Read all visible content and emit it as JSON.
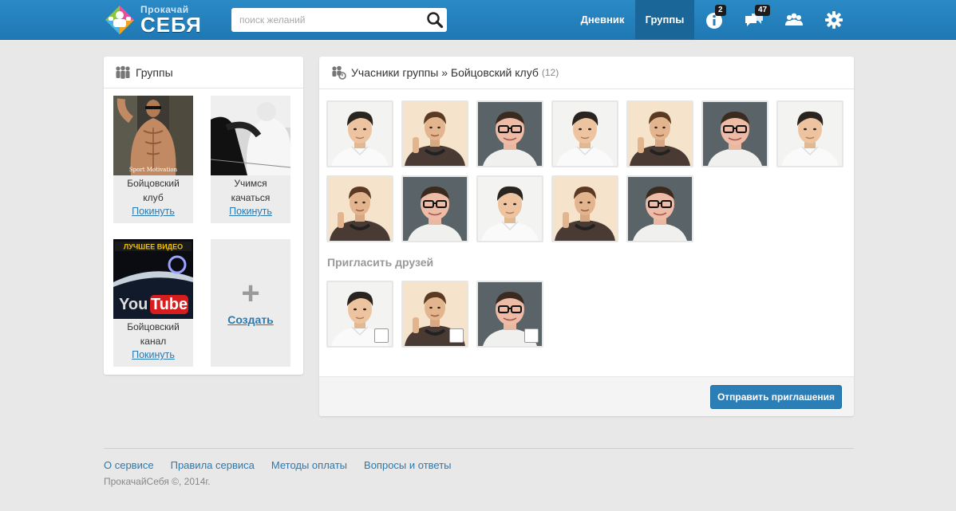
{
  "header": {
    "logo_small": "Прокачай",
    "logo_big": "СЕБЯ",
    "search_placeholder": "поиск желаний",
    "nav": {
      "diary": "Дневник",
      "groups": "Группы"
    },
    "badges": {
      "info": "2",
      "messages": "47"
    }
  },
  "groups": {
    "title": "Группы",
    "items": [
      {
        "name_line1": "Бойцовский",
        "name_line2": "клуб",
        "action": "Покинуть",
        "img_text": "Sport Motivation"
      },
      {
        "name_line1": "Учимся",
        "name_line2": "качаться",
        "action": "Покинуть"
      },
      {
        "name_line1": "Бойцовский",
        "name_line2": "канал",
        "action": "Покинуть",
        "img_top": "ЛУЧШЕЕ ВИДЕО",
        "img_you": "You",
        "img_tube": "Tube"
      }
    ],
    "create_plus": "+",
    "create_label": "Создать"
  },
  "members": {
    "title": "Учасники группы » Бойцовский клуб",
    "count": "(12)",
    "invite_title": "Пригласить друзей",
    "send_button": "Отправить приглашения"
  },
  "footer": {
    "links": [
      "О сервисе",
      "Правила сервиса",
      "Методы оплаты",
      "Вопросы и ответы"
    ],
    "copyright": "ПрокачайСебя ©, 2014г."
  },
  "colors": {
    "header": "#2280bd",
    "accent_link": "#2a7ab0",
    "button": "#2b7fb6"
  }
}
